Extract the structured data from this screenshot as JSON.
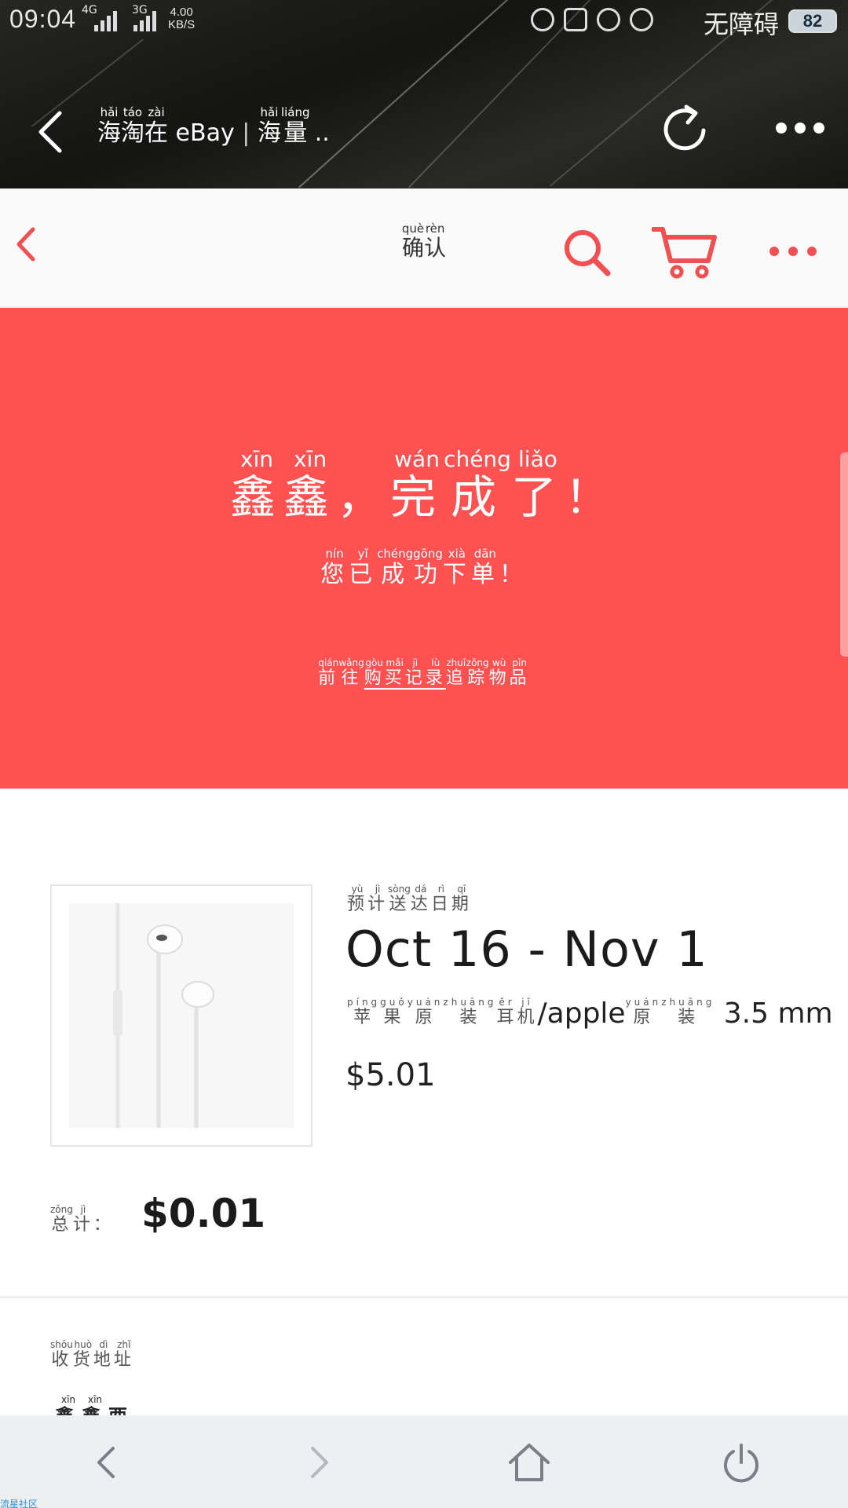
{
  "status_bar": {
    "time": "09:04",
    "network_1": "4G",
    "network_2": "3G",
    "speed_value": "4.00",
    "speed_unit": "KB/S",
    "accessibility": "无障碍",
    "battery": "82"
  },
  "browser": {
    "title_chars": [
      {
        "c": "海",
        "py": "hǎi"
      },
      {
        "c": "淘",
        "py": "táo"
      },
      {
        "c": "在",
        "py": "zài"
      }
    ],
    "title_latin": "eBay",
    "title_separator": "|",
    "title_chars_2": [
      {
        "c": "海",
        "py": "hǎi"
      },
      {
        "c": "量",
        "py": "liáng"
      }
    ],
    "title_ellipsis": ".."
  },
  "app_header": {
    "title_chars": [
      {
        "c": "确",
        "py": "què"
      },
      {
        "c": "认",
        "py": "rèn"
      }
    ]
  },
  "banner": {
    "headline": [
      {
        "c": "鑫",
        "py": "xīn"
      },
      {
        "c": "鑫",
        "py": "xīn"
      },
      {
        "c": "，",
        "py": ""
      },
      {
        "c": "完",
        "py": "wán"
      },
      {
        "c": "成",
        "py": "chéng"
      },
      {
        "c": "了",
        "py": "liǎo"
      },
      {
        "c": "！",
        "py": ""
      }
    ],
    "subline": [
      {
        "c": "您",
        "py": "nín"
      },
      {
        "c": "已",
        "py": "yǐ"
      },
      {
        "c": "成",
        "py": "chéng"
      },
      {
        "c": "功",
        "py": "gōng"
      },
      {
        "c": "下",
        "py": "xià"
      },
      {
        "c": "单",
        "py": "dān"
      },
      {
        "c": "！",
        "py": ""
      }
    ],
    "track_prefix": [
      {
        "c": "前",
        "py": "qián"
      },
      {
        "c": "往",
        "py": "wǎng"
      }
    ],
    "track_link": [
      {
        "c": "购",
        "py": "gòu"
      },
      {
        "c": "买",
        "py": "mǎi"
      },
      {
        "c": "记",
        "py": "jì"
      },
      {
        "c": "录",
        "py": "lù"
      }
    ],
    "track_suffix": [
      {
        "c": "追",
        "py": "zhuī"
      },
      {
        "c": "踪",
        "py": "zōng"
      },
      {
        "c": "物",
        "py": "wù"
      },
      {
        "c": "品",
        "py": "pǐn"
      }
    ]
  },
  "order": {
    "delivery_label": [
      {
        "c": "预",
        "py": "yù"
      },
      {
        "c": "计",
        "py": "jì"
      },
      {
        "c": "送",
        "py": "sòng"
      },
      {
        "c": "达",
        "py": "dá"
      },
      {
        "c": "日",
        "py": "rì"
      },
      {
        "c": "期",
        "py": "qī"
      }
    ],
    "delivery_date": "Oct 16 - Nov 1",
    "product_name_cn_1": [
      {
        "c": "苹",
        "py": "píng"
      },
      {
        "c": "果",
        "py": "guǒ"
      },
      {
        "c": "原",
        "py": "yuán"
      },
      {
        "c": "装",
        "py": "zhuāng"
      },
      {
        "c": "耳",
        "py": "ěr"
      },
      {
        "c": "机",
        "py": "jī"
      }
    ],
    "product_name_latin": "/apple",
    "product_name_cn_2": [
      {
        "c": "原",
        "py": "yuán"
      },
      {
        "c": "装",
        "py": "zhuāng"
      }
    ],
    "product_name_tail": "3.5 mm...",
    "price": "$5.01",
    "total_label": [
      {
        "c": "总",
        "py": "zǒng"
      },
      {
        "c": "计",
        "py": "jì"
      },
      {
        "c": "：",
        "py": ""
      }
    ],
    "total_value": "$0.01"
  },
  "address": {
    "label": [
      {
        "c": "收",
        "py": "shōu"
      },
      {
        "c": "货",
        "py": "huò"
      },
      {
        "c": "地",
        "py": "dì"
      },
      {
        "c": "址",
        "py": "zhǐ"
      }
    ],
    "name": [
      {
        "c": "鑫",
        "py": "xīn"
      },
      {
        "c": "鑫",
        "py": "xīn"
      },
      {
        "c": "酉",
        "py": ""
      }
    ]
  },
  "icons": {
    "browser_back": "chevron-left-icon",
    "browser_reload": "reload-icon",
    "browser_more": "more-icon",
    "app_back": "chevron-left-icon",
    "app_search": "search-icon",
    "app_cart": "cart-icon",
    "app_more": "more-icon",
    "nav_back": "chevron-left-icon",
    "nav_forward": "chevron-right-icon",
    "nav_home": "home-icon",
    "nav_power": "power-icon"
  },
  "colors": {
    "accent": "#fe5152",
    "header_bg": "#fafafa",
    "nav_bg": "#edf0f3"
  },
  "watermark": "流星社区"
}
